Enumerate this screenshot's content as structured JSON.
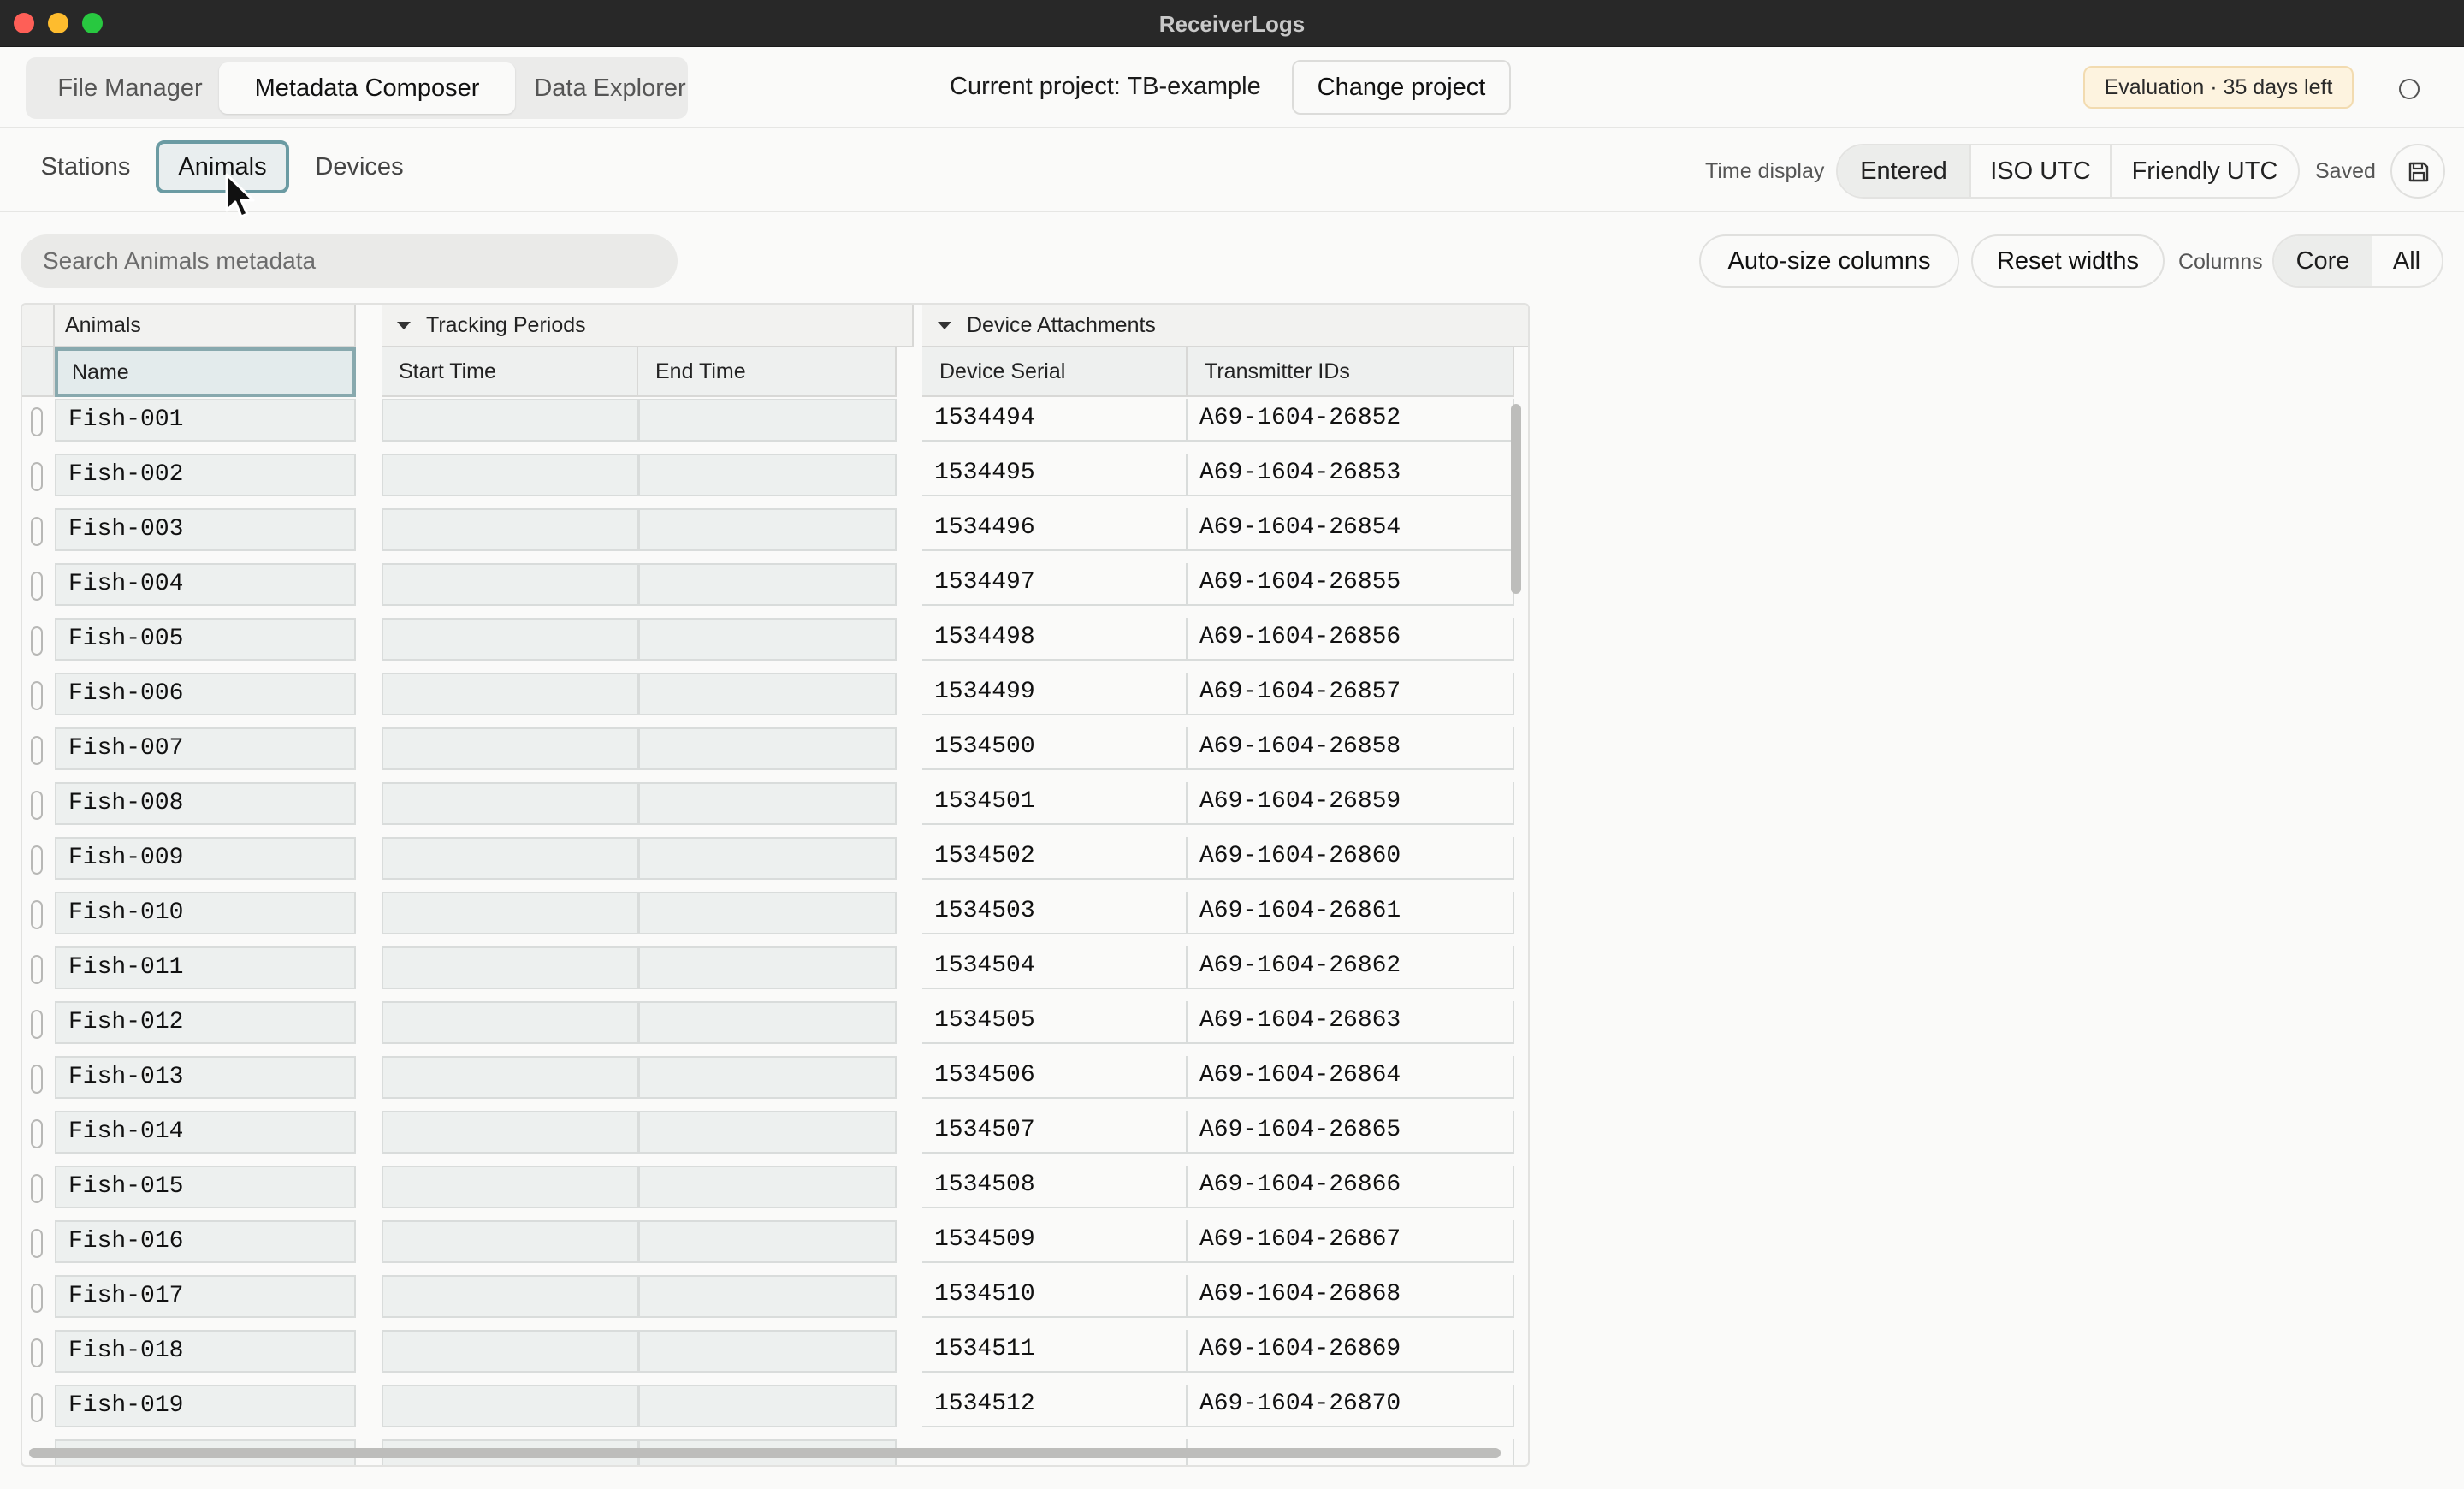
{
  "window": {
    "title": "ReceiverLogs"
  },
  "nav": {
    "tabs": [
      "File Manager",
      "Metadata Composer",
      "Data Explorer"
    ]
  },
  "project": {
    "label": "Current project: TB-example",
    "change_label": "Change project"
  },
  "evaluation": {
    "badge": "Evaluation · 35 days left"
  },
  "subtabs": [
    "Stations",
    "Animals",
    "Devices"
  ],
  "time_display": {
    "label": "Time display",
    "options": [
      "Entered",
      "ISO UTC",
      "Friendly UTC"
    ],
    "selected": "Entered"
  },
  "status": {
    "saved": "Saved"
  },
  "toolbar": {
    "search_placeholder": "Search Animals metadata",
    "autosize": "Auto-size columns",
    "reset": "Reset widths",
    "columns_label": "Columns",
    "columns_options": [
      "Core",
      "All"
    ],
    "columns_selected": "Core"
  },
  "grid": {
    "groups": [
      "Animals",
      "Tracking Periods",
      "Device Attachments"
    ],
    "headers": [
      "Name",
      "Start Time",
      "End Time",
      "Device Serial",
      "Transmitter IDs"
    ],
    "rows": [
      [
        "Fish-001",
        "",
        "",
        "1534494",
        "A69-1604-26852"
      ],
      [
        "Fish-002",
        "",
        "",
        "1534495",
        "A69-1604-26853"
      ],
      [
        "Fish-003",
        "",
        "",
        "1534496",
        "A69-1604-26854"
      ],
      [
        "Fish-004",
        "",
        "",
        "1534497",
        "A69-1604-26855"
      ],
      [
        "Fish-005",
        "",
        "",
        "1534498",
        "A69-1604-26856"
      ],
      [
        "Fish-006",
        "",
        "",
        "1534499",
        "A69-1604-26857"
      ],
      [
        "Fish-007",
        "",
        "",
        "1534500",
        "A69-1604-26858"
      ],
      [
        "Fish-008",
        "",
        "",
        "1534501",
        "A69-1604-26859"
      ],
      [
        "Fish-009",
        "",
        "",
        "1534502",
        "A69-1604-26860"
      ],
      [
        "Fish-010",
        "",
        "",
        "1534503",
        "A69-1604-26861"
      ],
      [
        "Fish-011",
        "",
        "",
        "1534504",
        "A69-1604-26862"
      ],
      [
        "Fish-012",
        "",
        "",
        "1534505",
        "A69-1604-26863"
      ],
      [
        "Fish-013",
        "",
        "",
        "1534506",
        "A69-1604-26864"
      ],
      [
        "Fish-014",
        "",
        "",
        "1534507",
        "A69-1604-26865"
      ],
      [
        "Fish-015",
        "",
        "",
        "1534508",
        "A69-1604-26866"
      ],
      [
        "Fish-016",
        "",
        "",
        "1534509",
        "A69-1604-26867"
      ],
      [
        "Fish-017",
        "",
        "",
        "1534510",
        "A69-1604-26868"
      ],
      [
        "Fish-018",
        "",
        "",
        "1534511",
        "A69-1604-26869"
      ],
      [
        "Fish-019",
        "",
        "",
        "1534512",
        "A69-1604-26870"
      ]
    ]
  }
}
